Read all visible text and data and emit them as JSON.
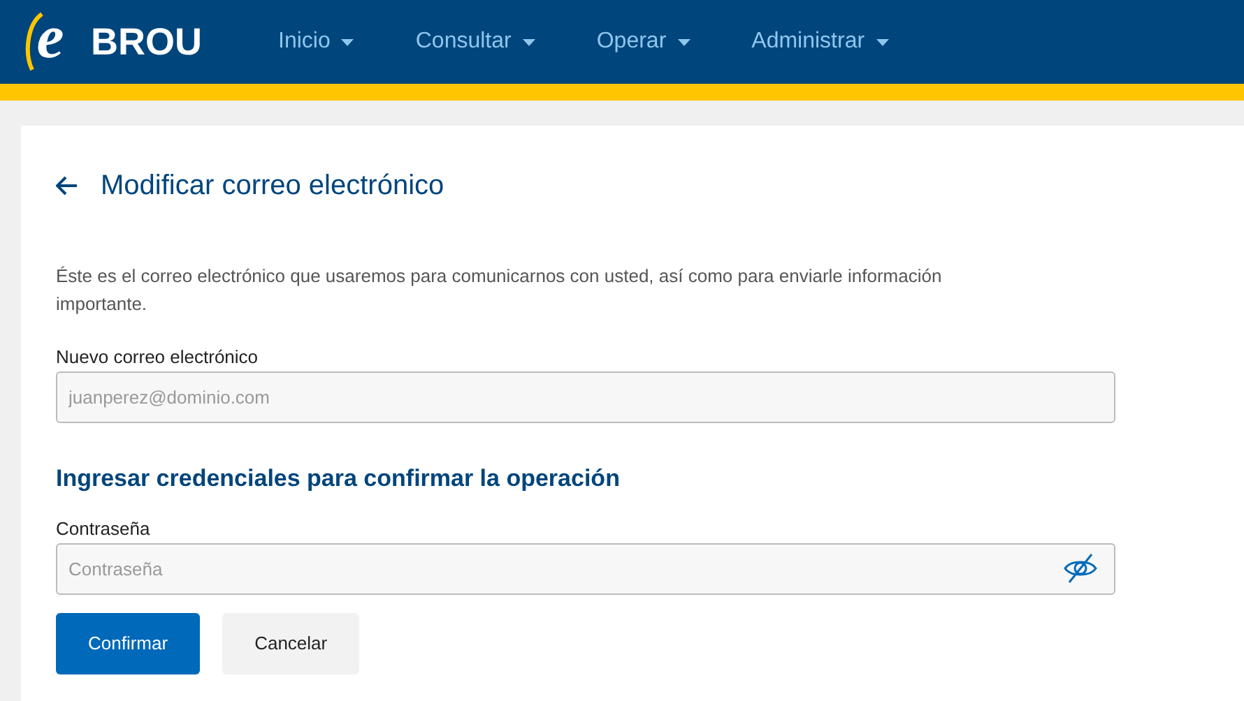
{
  "header": {
    "logo_letter": "e",
    "logo_text": "BROU",
    "nav": [
      {
        "label": "Inicio"
      },
      {
        "label": "Consultar"
      },
      {
        "label": "Operar"
      },
      {
        "label": "Administrar"
      }
    ]
  },
  "page": {
    "title": "Modificar correo electrónico",
    "description": "Éste es el correo electrónico que usaremos para comunicarnos con usted, así como para enviarle información importante.",
    "email_field": {
      "label": "Nuevo correo electrónico",
      "placeholder": "juanperez@dominio.com"
    },
    "credentials_heading": "Ingresar credenciales para confirmar la operación",
    "password_field": {
      "label": "Contraseña",
      "placeholder": "Contraseña",
      "hidden": true
    },
    "buttons": [
      {
        "label": "Confirmar",
        "kind": "primary"
      },
      {
        "label": "Cancelar",
        "kind": "secondary"
      }
    ]
  }
}
